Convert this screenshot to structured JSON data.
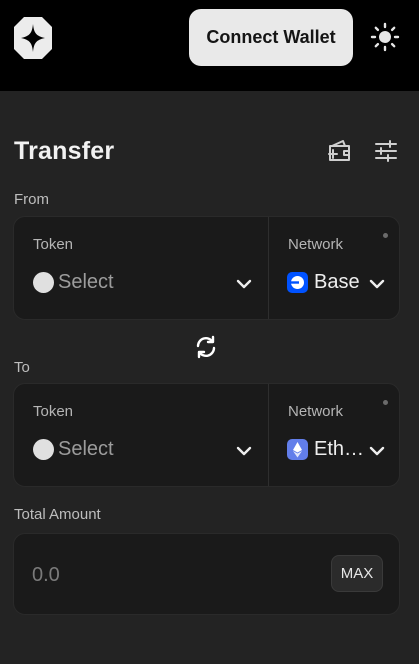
{
  "header": {
    "connect_label": "Connect Wallet",
    "icons": [
      "star-logo-icon",
      "sun-icon"
    ]
  },
  "main": {
    "title": "Transfer",
    "icons": [
      "wallet-add-icon",
      "sliders-icon",
      "swap-arrows-icon",
      "chevron-down-icon"
    ],
    "from": {
      "section_label": "From",
      "token_label": "Token",
      "token_value": "Select",
      "network_label": "Network",
      "network_value": "Base",
      "network_icon": "base-network-icon"
    },
    "to": {
      "section_label": "To",
      "token_label": "Token",
      "token_value": "Select",
      "network_label": "Network",
      "network_value": "Eth…",
      "network_icon": "ethereum-network-icon"
    },
    "amount": {
      "section_label": "Total Amount",
      "placeholder": "0.0",
      "max_label": "MAX"
    }
  },
  "colors": {
    "background": "#232323",
    "topbar": "#000000",
    "panel": "#1a1a1a",
    "base_blue": "#0052ff",
    "eth_purple": "#627eea"
  }
}
